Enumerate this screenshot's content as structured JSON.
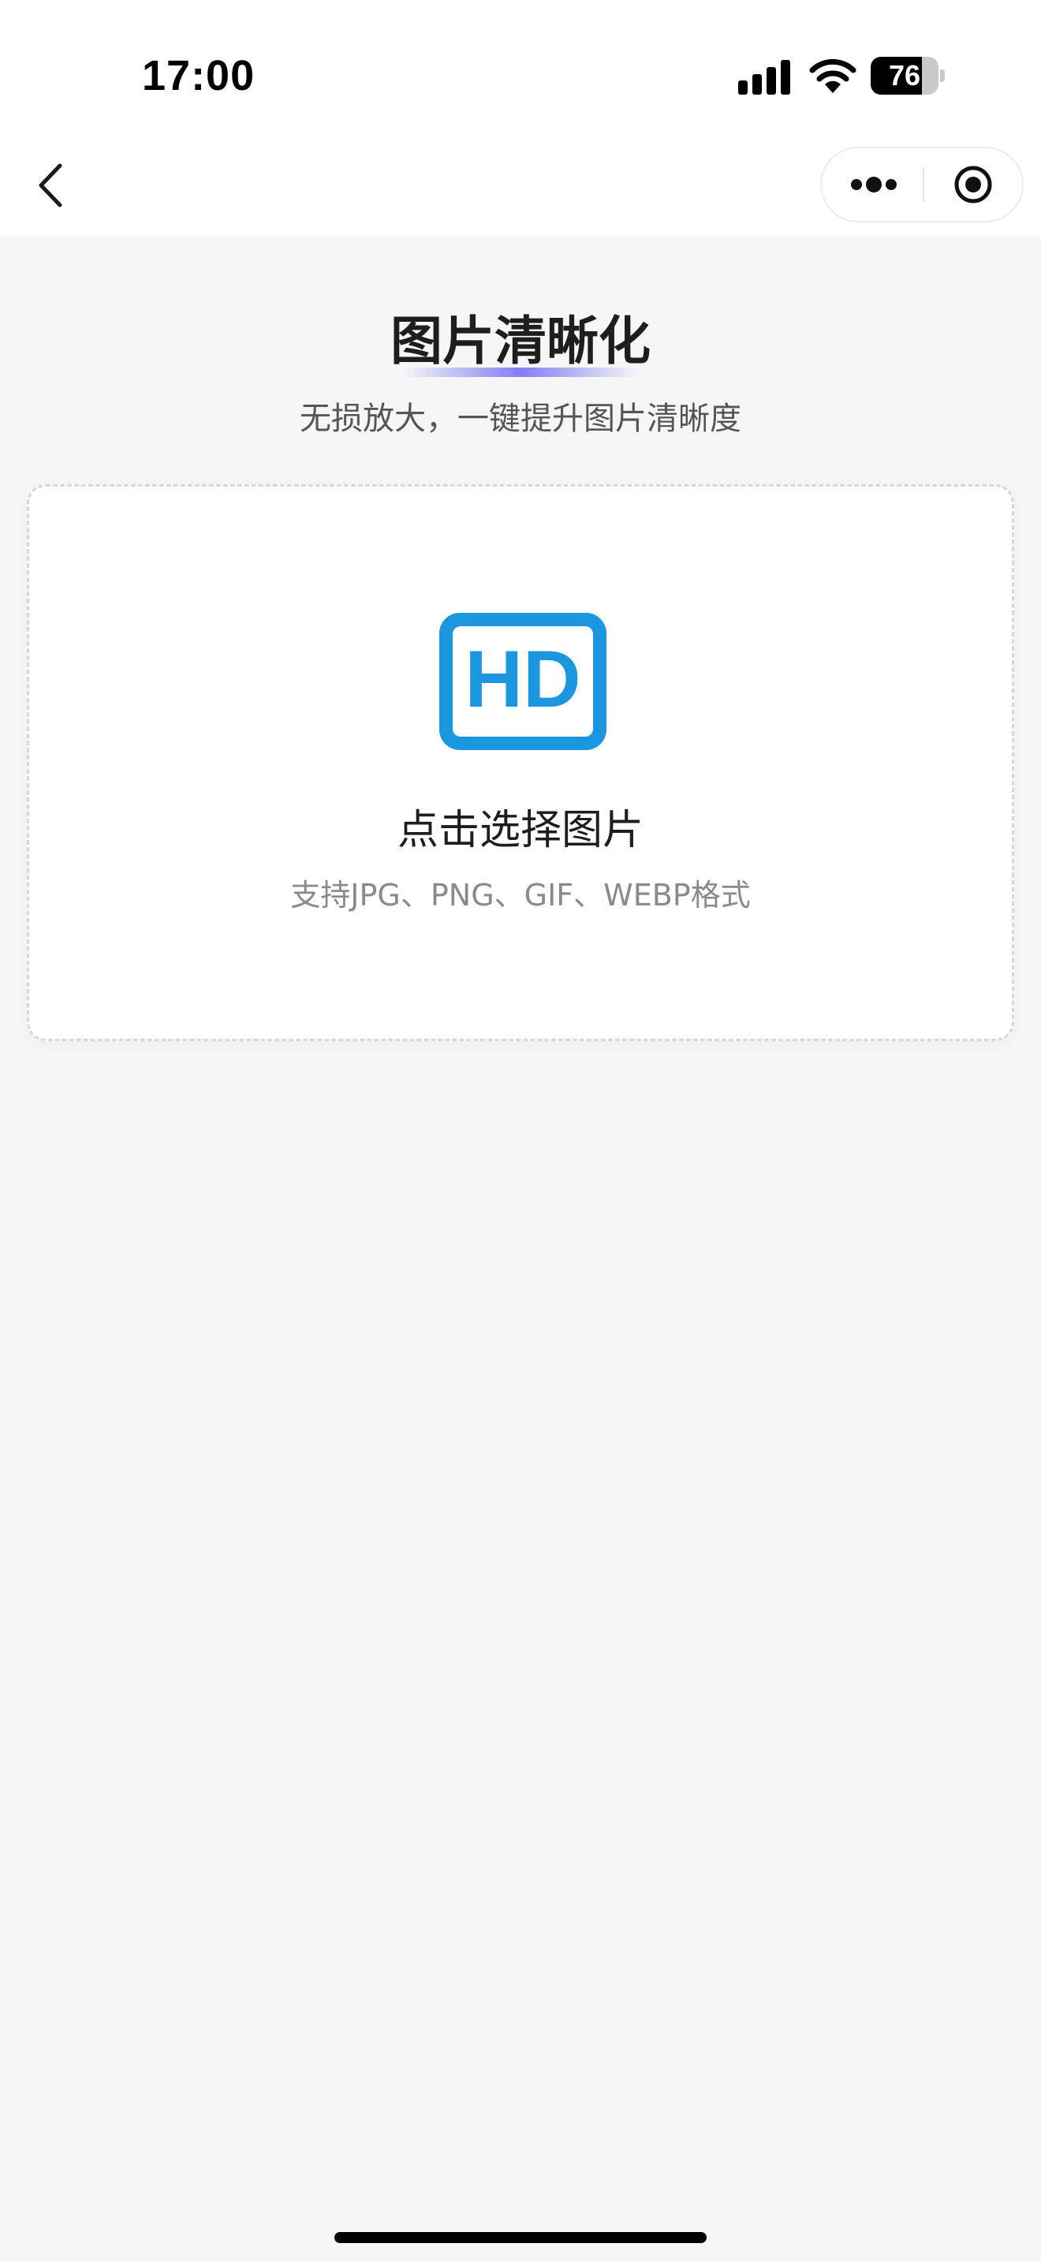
{
  "status_bar": {
    "time": "17:00",
    "battery_level": "76",
    "battery_fraction": 0.76
  },
  "nav": {
    "back_icon": "chevron-left-icon",
    "more_icon": "more-dots-icon",
    "close_icon": "target-close-icon"
  },
  "header": {
    "title": "图片清晰化",
    "subtitle": "无损放大，一键提升图片清晰度"
  },
  "upload": {
    "icon": "hd-icon",
    "icon_text": "HD",
    "label": "点击选择图片",
    "hint": "支持JPG、PNG、GIF、WEBP格式"
  },
  "colors": {
    "accent": "#1a97df",
    "title_underline": "#6e69f5",
    "page_background": "#f6f6f6"
  }
}
